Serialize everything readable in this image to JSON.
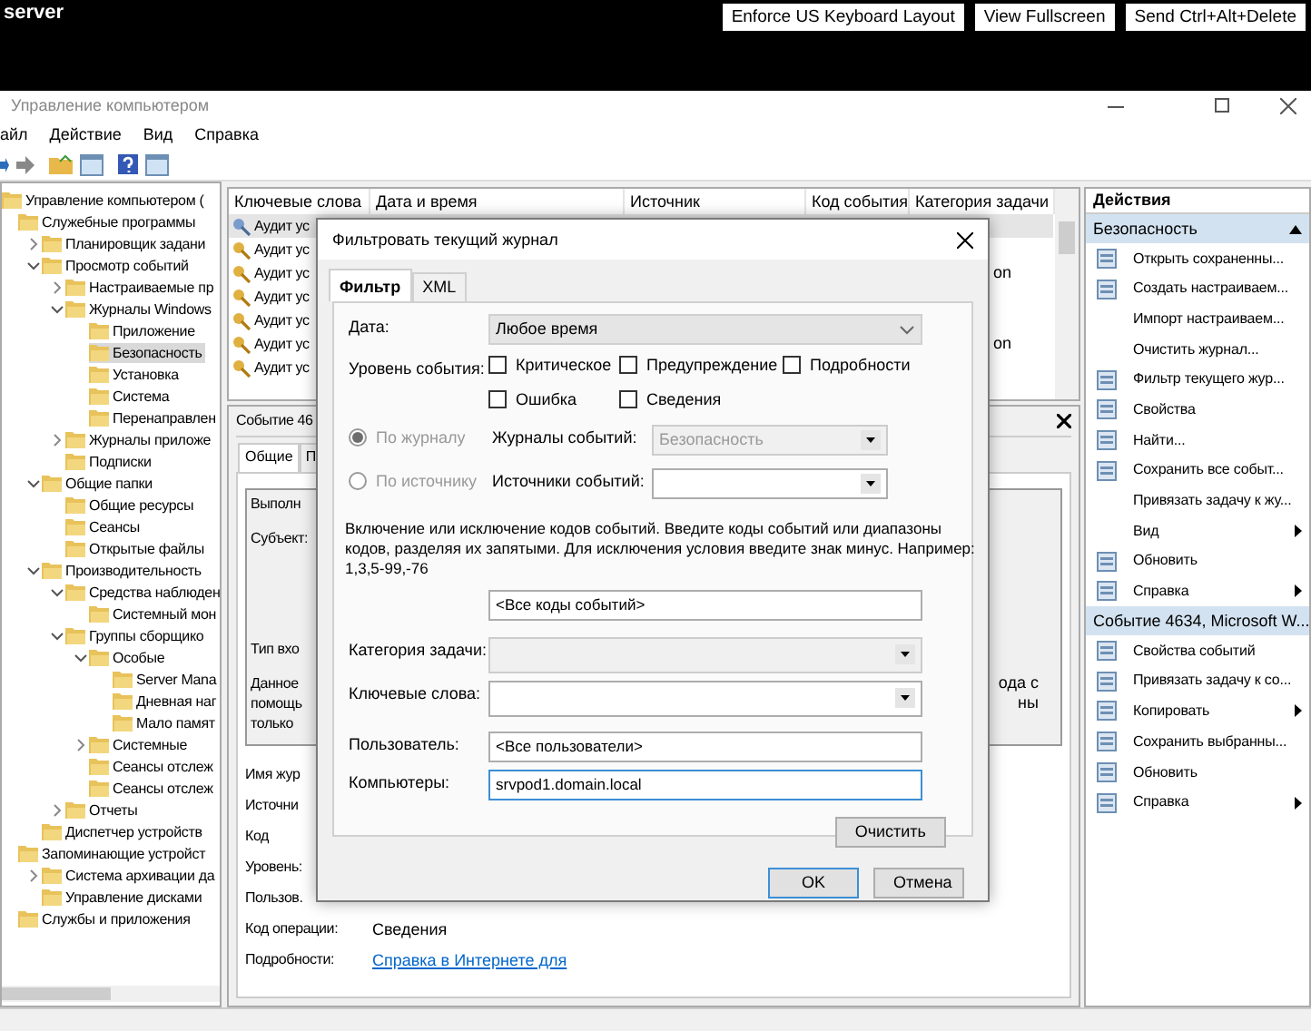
{
  "session_bar": {
    "host": "server",
    "buttons": [
      "Enforce US Keyboard Layout",
      "View Fullscreen",
      "Send Ctrl+Alt+Delete"
    ]
  },
  "window": {
    "title": "Управление компьютером"
  },
  "menu": [
    "айл",
    "Действие",
    "Вид",
    "Справка"
  ],
  "tree": [
    {
      "label": "Управление компьютером (",
      "selected": false,
      "children": [
        {
          "label": "Служебные программы",
          "selected": false,
          "children": [
            {
              "label": "Планировщик задани",
              "selected": false,
              "expanded": false
            },
            {
              "label": "Просмотр событий",
              "selected": false,
              "expanded": true,
              "children": [
                {
                  "label": "Настраиваемые пр",
                  "selected": false,
                  "expanded": false
                },
                {
                  "label": "Журналы Windows",
                  "selected": false,
                  "expanded": true,
                  "children": [
                    {
                      "label": "Приложение",
                      "selected": false
                    },
                    {
                      "label": "Безопасность",
                      "selected": true
                    },
                    {
                      "label": "Установка",
                      "selected": false
                    },
                    {
                      "label": "Система",
                      "selected": false
                    },
                    {
                      "label": "Перенаправлен",
                      "selected": false
                    }
                  ]
                },
                {
                  "label": "Журналы приложе",
                  "selected": false,
                  "expanded": false
                },
                {
                  "label": "Подписки",
                  "selected": false
                }
              ]
            },
            {
              "label": "Общие папки",
              "selected": false,
              "expanded": true,
              "children": [
                {
                  "label": "Общие ресурсы",
                  "selected": false
                },
                {
                  "label": "Сеансы",
                  "selected": false
                },
                {
                  "label": "Открытые файлы",
                  "selected": false
                }
              ]
            },
            {
              "label": "Производительность",
              "selected": false,
              "expanded": true,
              "children": [
                {
                  "label": "Средства наблюден",
                  "selected": false,
                  "expanded": true,
                  "children": [
                    {
                      "label": "Системный мон",
                      "selected": false
                    }
                  ]
                },
                {
                  "label": "Группы сборщико",
                  "selected": false,
                  "expanded": true,
                  "children": [
                    {
                      "label": "Особые",
                      "selected": false,
                      "expanded": true,
                      "children": [
                        {
                          "label": "Server Mana",
                          "selected": false
                        },
                        {
                          "label": "Дневная наг",
                          "selected": false
                        },
                        {
                          "label": "Мало памят",
                          "selected": false
                        }
                      ]
                    },
                    {
                      "label": "Системные",
                      "selected": false,
                      "expanded": false
                    },
                    {
                      "label": "Сеансы отслеж",
                      "selected": false
                    },
                    {
                      "label": "Сеансы отслеж",
                      "selected": false
                    }
                  ]
                },
                {
                  "label": "Отчеты",
                  "selected": false,
                  "expanded": false
                }
              ]
            },
            {
              "label": "Диспетчер устройств",
              "selected": false
            }
          ]
        },
        {
          "label": "Запоминающие устройст",
          "selected": false,
          "children": [
            {
              "label": "Система архивации да",
              "selected": false,
              "expanded": false
            },
            {
              "label": "Управление дисками",
              "selected": false
            }
          ]
        },
        {
          "label": "Службы и приложения",
          "selected": false
        }
      ]
    }
  ],
  "event_list": {
    "columns": [
      "Ключевые слова",
      "Дата и время",
      "Источник",
      "Код события",
      "Категория задачи"
    ],
    "rows": [
      {
        "keywords": "Аудит ус",
        "selected": true
      },
      {
        "keywords": "Аудит ус",
        "selected": false
      },
      {
        "keywords": "Аудит ус",
        "category": "on",
        "selected": false
      },
      {
        "keywords": "Аудит ус",
        "selected": false
      },
      {
        "keywords": "Аудит ус",
        "selected": false
      },
      {
        "keywords": "Аудит ус",
        "category": "on",
        "selected": false
      },
      {
        "keywords": "Аудит ус",
        "selected": false
      }
    ]
  },
  "event_panel": {
    "title": "Событие 46",
    "tabs": [
      {
        "label": "Общие",
        "selected": true
      },
      {
        "label": "П",
        "selected": false
      }
    ],
    "description": [
      [
        {
          "text": "Выполн"
        }
      ],
      [
        {
          "text": "Субъект:"
        }
      ],
      [
        {
          "text": "Тип вхо"
        }
      ],
      [
        {
          "text": "Данное",
          "tail": "ода с"
        },
        {
          "text": "помощь",
          "tail": "ны"
        },
        {
          "text": "только"
        }
      ]
    ],
    "fields": [
      {
        "label": "Имя жур"
      },
      {
        "label": "Источни"
      },
      {
        "label": "Код"
      },
      {
        "label": "Уровень:"
      },
      {
        "label": "Пользов."
      },
      {
        "label": "Код операции:",
        "value": "Сведения"
      },
      {
        "label": "Подробности:",
        "link": "Справка в Интернете для"
      }
    ]
  },
  "actions": {
    "title": "Действия",
    "groups": [
      {
        "title": "Безопасность",
        "items": [
          {
            "label": "Открыть сохраненны...",
            "icon": true,
            "submenu": false
          },
          {
            "label": "Создать настраиваем...",
            "icon": true,
            "submenu": false
          },
          {
            "label": "Импорт настраиваем...",
            "icon": false,
            "submenu": false
          },
          {
            "label": "Очистить журнал...",
            "icon": false,
            "submenu": false
          },
          {
            "label": "Фильтр текущего жур...",
            "icon": true,
            "submenu": false
          },
          {
            "label": "Свойства",
            "icon": true,
            "submenu": false
          },
          {
            "label": "Найти...",
            "icon": true,
            "submenu": false
          },
          {
            "label": "Сохранить все событ...",
            "icon": true,
            "submenu": false
          },
          {
            "label": "Привязать задачу к жу...",
            "icon": false,
            "submenu": false
          },
          {
            "label": "Вид",
            "icon": false,
            "submenu": true
          },
          {
            "label": "Обновить",
            "icon": true,
            "submenu": false
          },
          {
            "label": "Справка",
            "icon": true,
            "submenu": true
          }
        ]
      },
      {
        "title": "Событие 4634, Microsoft W...",
        "items": [
          {
            "label": "Свойства событий",
            "icon": true,
            "submenu": false
          },
          {
            "label": "Привязать задачу к со...",
            "icon": true,
            "submenu": false
          },
          {
            "label": "Копировать",
            "icon": true,
            "submenu": true
          },
          {
            "label": "Сохранить выбранны...",
            "icon": true,
            "submenu": false
          },
          {
            "label": "Обновить",
            "icon": true,
            "submenu": false
          },
          {
            "label": "Справка",
            "icon": true,
            "submenu": true
          }
        ]
      }
    ]
  },
  "filter_dialog": {
    "title": "Фильтровать текущий журнал",
    "tabs": [
      {
        "label": "Фильтр",
        "selected": true
      },
      {
        "label": "XML",
        "selected": false
      }
    ],
    "date": {
      "label": "Дата:",
      "value": "Любое время"
    },
    "event_level": {
      "label": "Уровень события:",
      "options": [
        {
          "label": "Критическое",
          "checked": false
        },
        {
          "label": "Предупреждение",
          "checked": false
        },
        {
          "label": "Подробности",
          "checked": false
        },
        {
          "label": "Ошибка",
          "checked": false
        },
        {
          "label": "Сведения",
          "checked": false
        }
      ]
    },
    "sources": [
      {
        "label": "По журналу",
        "selected": true,
        "disabled": true,
        "field_label": "Журналы событий:",
        "value": "Безопасность",
        "field_disabled": true
      },
      {
        "label": "По источнику",
        "selected": false,
        "disabled": true,
        "field_label": "Источники событий:",
        "field_disabled": false
      }
    ],
    "event_ids": {
      "hint": "Включение или исключение кодов событий. Введите коды событий или диапазоны кодов, разделяя их запятыми. Для исключения условия введите знак минус. Например: 1,3,5-99,-76",
      "value": "<Все коды событий>"
    },
    "task_category": {
      "label": "Категория задачи:",
      "disabled": true
    },
    "keywords": {
      "label": "Ключевые слова:",
      "disabled": false
    },
    "user": {
      "label": "Пользователь:",
      "value": "<Все пользователи>",
      "focused": false
    },
    "computer": {
      "label": "Компьютеры:",
      "value": "srvpod1.domain.local",
      "focused": true
    },
    "clear_button": "Очистить",
    "buttons": [
      {
        "label": "OK",
        "default": true
      },
      {
        "label": "Отмена",
        "default": false
      }
    ]
  }
}
